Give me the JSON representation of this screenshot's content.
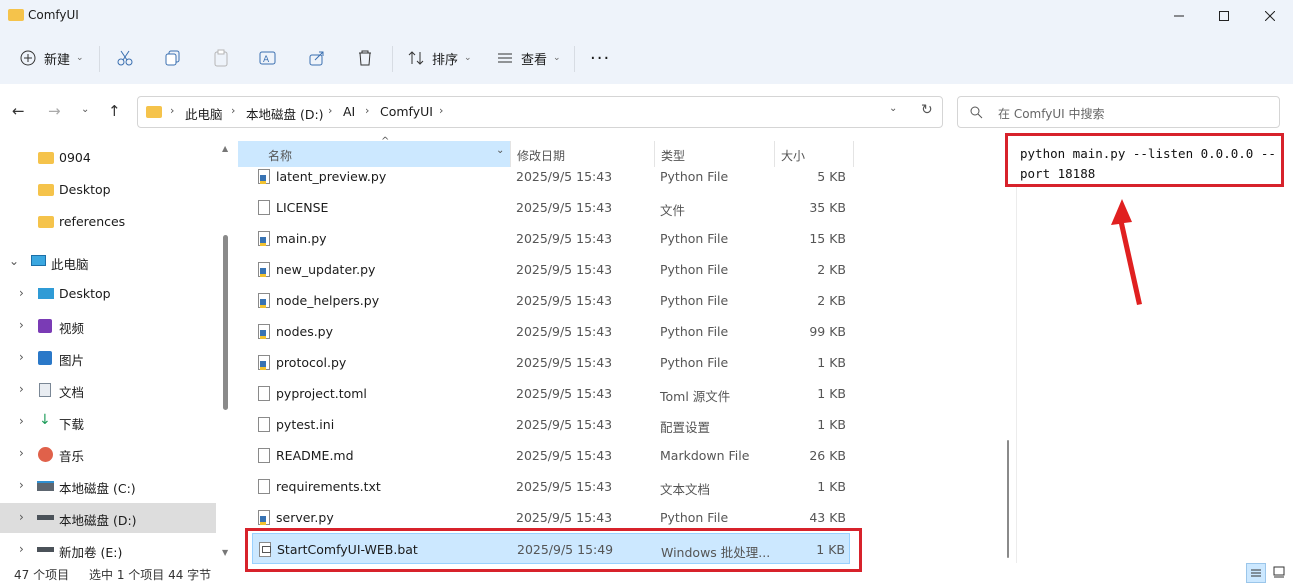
{
  "window": {
    "title": "ComfyUI"
  },
  "toolbar": {
    "new_label": "新建",
    "sort_label": "排序",
    "view_label": "查看"
  },
  "address": {
    "crumbs": [
      "此电脑",
      "本地磁盘 (D:)",
      "AI",
      "ComfyUI"
    ]
  },
  "search": {
    "placeholder": "在 ComfyUI 中搜索"
  },
  "nav": {
    "quick": [
      "0904",
      "Desktop",
      "references"
    ],
    "this_pc": "此电脑",
    "pc_items": [
      "Desktop",
      "视频",
      "图片",
      "文档",
      "下载",
      "音乐",
      "本地磁盘 (C:)",
      "本地磁盘 (D:)",
      "新加卷 (E:)"
    ]
  },
  "columns": {
    "name": "名称",
    "date": "修改日期",
    "type": "类型",
    "size": "大小"
  },
  "files": [
    {
      "name": "latent_preview.py",
      "date": "2025/9/5 15:43",
      "type": "Python File",
      "size": "5 KB",
      "icon": "py"
    },
    {
      "name": "LICENSE",
      "date": "2025/9/5 15:43",
      "type": "文件",
      "size": "35 KB",
      "icon": "doc"
    },
    {
      "name": "main.py",
      "date": "2025/9/5 15:43",
      "type": "Python File",
      "size": "15 KB",
      "icon": "py"
    },
    {
      "name": "new_updater.py",
      "date": "2025/9/5 15:43",
      "type": "Python File",
      "size": "2 KB",
      "icon": "py"
    },
    {
      "name": "node_helpers.py",
      "date": "2025/9/5 15:43",
      "type": "Python File",
      "size": "2 KB",
      "icon": "py"
    },
    {
      "name": "nodes.py",
      "date": "2025/9/5 15:43",
      "type": "Python File",
      "size": "99 KB",
      "icon": "py"
    },
    {
      "name": "protocol.py",
      "date": "2025/9/5 15:43",
      "type": "Python File",
      "size": "1 KB",
      "icon": "py"
    },
    {
      "name": "pyproject.toml",
      "date": "2025/9/5 15:43",
      "type": "Toml 源文件",
      "size": "1 KB",
      "icon": "doc"
    },
    {
      "name": "pytest.ini",
      "date": "2025/9/5 15:43",
      "type": "配置设置",
      "size": "1 KB",
      "icon": "doc"
    },
    {
      "name": "README.md",
      "date": "2025/9/5 15:43",
      "type": "Markdown File",
      "size": "26 KB",
      "icon": "doc"
    },
    {
      "name": "requirements.txt",
      "date": "2025/9/5 15:43",
      "type": "文本文档",
      "size": "1 KB",
      "icon": "doc"
    },
    {
      "name": "server.py",
      "date": "2025/9/5 15:43",
      "type": "Python File",
      "size": "43 KB",
      "icon": "py"
    },
    {
      "name": "StartComfyUI-WEB.bat",
      "date": "2025/9/5 15:49",
      "type": "Windows 批处理...",
      "size": "1 KB",
      "icon": "bat",
      "selected": true
    }
  ],
  "status": {
    "count": "47 个项目",
    "selected": "选中 1 个项目 44 字节"
  },
  "annotation": {
    "text": "python main.py --listen 0.0.0.0 --port 18188"
  },
  "colors": {
    "accent": "#0067c0",
    "highlight": "#d7222b",
    "selection": "#cce8ff"
  }
}
